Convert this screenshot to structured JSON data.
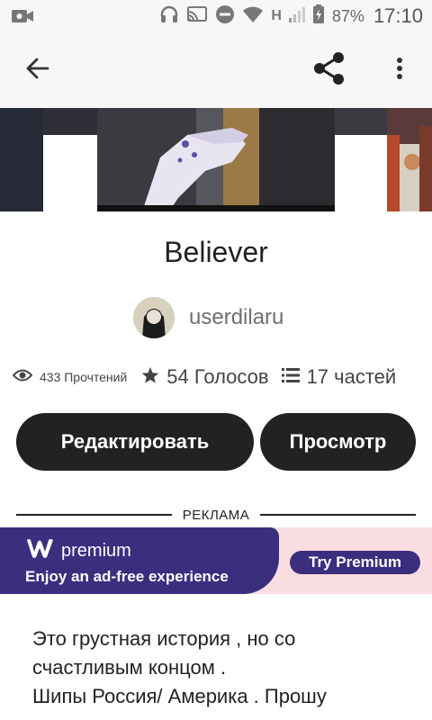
{
  "status_bar": {
    "network_label": "H",
    "battery_percent": "87%",
    "time": "17:10"
  },
  "story": {
    "title": "Believer",
    "author": "userdilaru"
  },
  "stats": {
    "reads": "433 Прочтений",
    "votes": "54 Голосов",
    "parts": "17 частей"
  },
  "actions": {
    "edit_label": "Редактировать",
    "view_label": "Просмотр"
  },
  "ad": {
    "label": "РЕКЛАМА",
    "brand": "premium",
    "tagline": "Enjoy an ad-free experience",
    "cta": "Try Premium"
  },
  "description": {
    "line1": "Это грустная история , но со",
    "line2": "счастливым концом .",
    "line3": "Шипы Россия/ Америка . Прошу"
  },
  "icons": {
    "back": "arrow-left-icon",
    "share": "share-icon",
    "more": "more-vert-icon"
  }
}
